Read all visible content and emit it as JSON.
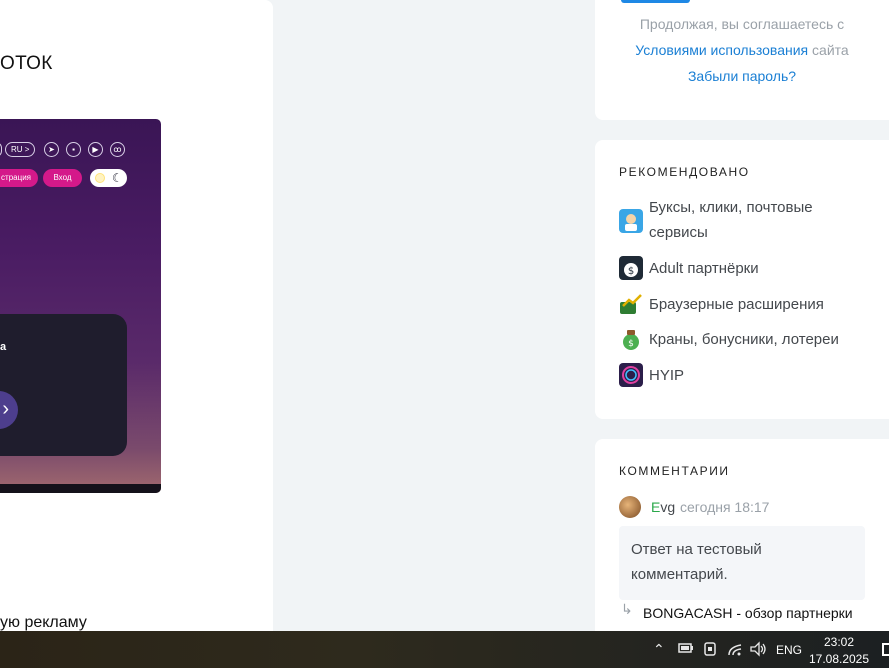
{
  "main": {
    "heading": "ОТОК",
    "bottom_text": "ую рекламу",
    "embed": {
      "lang_pill": "RU >",
      "social_icons": [
        "telegram-icon",
        "vk-icon",
        "youtube-icon",
        "odnoklassniki-icon"
      ],
      "register_label": "страция",
      "login_label": "Вход",
      "card_text": "a",
      "arrow_glyph": "›"
    }
  },
  "sidebar": {
    "login": {
      "terms_prefix": "Продолжая, вы соглашаетесь с",
      "terms_link": "Условиями использования",
      "terms_suffix": " сайта",
      "forgot_password": "Забыли пароль?"
    },
    "recommended": {
      "title": "РЕКОМЕНДОВАНО",
      "items": [
        {
          "label_line1": "Буксы, клики, почтовые",
          "label_line2": "сервисы",
          "icon": "clicks-mascot-icon",
          "color": "#3aa6e6"
        },
        {
          "label": "Adult партнёрки",
          "icon": "money-bag-icon",
          "color": "#1f2a36"
        },
        {
          "label": "Браузерные расширения",
          "icon": "money-growth-icon",
          "color": "#2e7d32"
        },
        {
          "label": "Краны, бонусники, лотереи",
          "icon": "cash-bag-icon",
          "color": "#4caf50"
        },
        {
          "label": "HYIP",
          "icon": "hyip-icon",
          "color": "#2b1e4a"
        }
      ]
    },
    "comments": {
      "title": "КОММЕНТАРИИ",
      "author_first": "E",
      "author_rest": "vg",
      "time": "сегодня 18:17",
      "text_line1": "Ответ на тестовый",
      "text_line2": "комментарий.",
      "reply_to": "BONGACASH - обзор партнерки"
    }
  },
  "taskbar": {
    "lang": "ENG",
    "time": "23:02",
    "date": "17.08.2025"
  }
}
